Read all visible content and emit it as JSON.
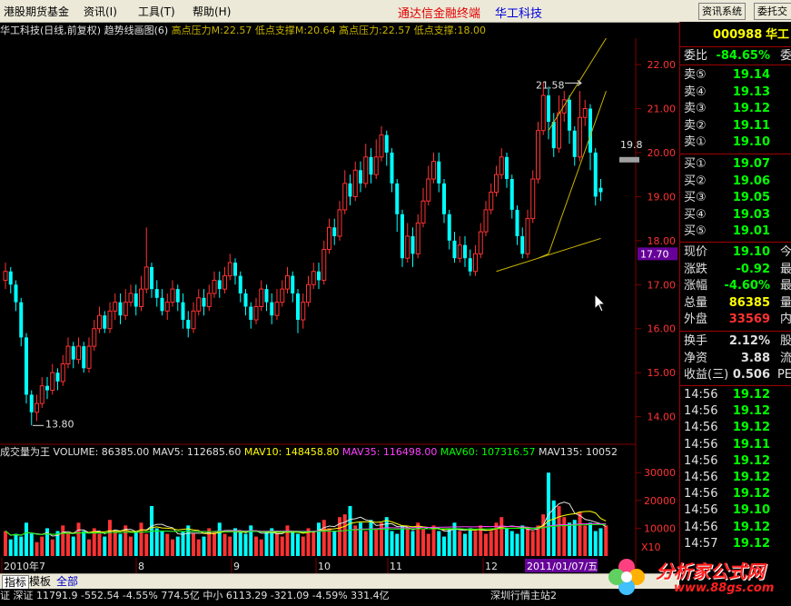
{
  "menubar": {
    "items": [
      {
        "label": "港股期货基金"
      },
      {
        "label": "资讯(I)"
      },
      {
        "label": "工具(T)"
      },
      {
        "label": "帮助(H)"
      }
    ],
    "app_title": "通达信金融终端",
    "stock_title": "华工科技",
    "btn_info": "资讯系统",
    "btn_trade": "委托交"
  },
  "chart_header": {
    "name": "华工科技(日线,前复权) 趋势线画图(6)",
    "hp_label": "高点压力M:",
    "hp_value": "22.57",
    "ls_label": "低点支撑M:",
    "ls_value": "20.64",
    "hp2_label": "高点压力:",
    "hp2_value": "22.57",
    "ls2_label": "低点支撑:",
    "ls2_value": "18.00"
  },
  "colors": {
    "up": "#ff3232",
    "down": "#00ffff",
    "trendline": "#c8b400",
    "grid": "#7f0000",
    "highlight": "#660099"
  },
  "chart_data": {
    "type": "candlestick",
    "ylim": [
      13.6,
      22.6
    ],
    "yticks": [
      "22.00",
      "21.00",
      "20.00",
      "19.00",
      "18.00",
      "17.00",
      "16.00",
      "15.00",
      "14.00"
    ],
    "annotations": {
      "high_label": "21.58",
      "low_label": "13.80",
      "right_label": "19.8",
      "price_tag": "17.70"
    },
    "candles": [
      [
        17.1,
        17.3,
        17.5,
        16.9
      ],
      [
        17.3,
        17.0,
        17.4,
        16.8
      ],
      [
        17.0,
        16.6,
        17.1,
        16.4
      ],
      [
        16.6,
        15.8,
        16.7,
        15.6
      ],
      [
        15.8,
        14.5,
        15.9,
        14.3
      ],
      [
        14.5,
        14.1,
        14.6,
        13.8
      ],
      [
        14.1,
        14.3,
        14.5,
        13.9
      ],
      [
        14.3,
        14.7,
        14.9,
        14.2
      ],
      [
        14.7,
        14.6,
        14.9,
        14.4
      ],
      [
        14.6,
        15.0,
        15.2,
        14.5
      ],
      [
        15.0,
        14.8,
        15.1,
        14.6
      ],
      [
        14.8,
        15.2,
        15.4,
        14.7
      ],
      [
        15.2,
        15.6,
        15.8,
        15.1
      ],
      [
        15.6,
        15.3,
        15.7,
        15.1
      ],
      [
        15.3,
        15.6,
        15.8,
        15.2
      ],
      [
        15.6,
        15.1,
        15.7,
        15.0
      ],
      [
        15.1,
        15.6,
        15.8,
        15.0
      ],
      [
        15.6,
        16.0,
        16.2,
        15.5
      ],
      [
        16.0,
        16.3,
        16.5,
        15.9
      ],
      [
        16.3,
        16.0,
        16.4,
        15.9
      ],
      [
        16.0,
        16.4,
        16.6,
        15.9
      ],
      [
        16.4,
        16.6,
        16.8,
        16.2
      ],
      [
        16.6,
        16.3,
        16.8,
        16.1
      ],
      [
        16.3,
        16.6,
        16.9,
        16.2
      ],
      [
        16.6,
        16.8,
        17.0,
        16.5
      ],
      [
        16.8,
        16.5,
        17.0,
        16.3
      ],
      [
        16.5,
        16.9,
        17.2,
        16.4
      ],
      [
        16.9,
        17.4,
        18.3,
        16.8
      ],
      [
        17.4,
        16.9,
        17.5,
        16.7
      ],
      [
        16.9,
        16.7,
        17.1,
        16.5
      ],
      [
        16.7,
        16.4,
        16.9,
        16.3
      ],
      [
        16.4,
        16.6,
        16.8,
        16.2
      ],
      [
        16.6,
        16.9,
        17.1,
        16.5
      ],
      [
        16.9,
        16.6,
        17.0,
        16.4
      ],
      [
        16.6,
        16.2,
        16.8,
        16.0
      ],
      [
        16.2,
        16.0,
        16.4,
        15.8
      ],
      [
        16.0,
        16.4,
        16.6,
        15.9
      ],
      [
        16.4,
        16.7,
        16.9,
        16.3
      ],
      [
        16.7,
        16.5,
        16.9,
        16.3
      ],
      [
        16.5,
        16.8,
        17.0,
        16.4
      ],
      [
        16.8,
        17.1,
        17.3,
        16.7
      ],
      [
        17.1,
        16.9,
        17.3,
        16.7
      ],
      [
        16.9,
        17.2,
        17.4,
        16.8
      ],
      [
        17.2,
        17.5,
        17.7,
        17.1
      ],
      [
        17.5,
        17.2,
        17.6,
        17.0
      ],
      [
        17.2,
        16.8,
        17.3,
        16.6
      ],
      [
        16.8,
        16.5,
        16.9,
        16.3
      ],
      [
        16.5,
        16.2,
        16.6,
        16.0
      ],
      [
        16.2,
        16.5,
        16.7,
        16.1
      ],
      [
        16.5,
        16.9,
        17.1,
        16.4
      ],
      [
        16.9,
        16.6,
        17.0,
        16.4
      ],
      [
        16.6,
        16.3,
        16.8,
        16.1
      ],
      [
        16.3,
        16.6,
        16.9,
        16.2
      ],
      [
        16.6,
        16.9,
        17.1,
        16.5
      ],
      [
        16.9,
        17.2,
        17.4,
        16.8
      ],
      [
        17.2,
        16.8,
        17.3,
        16.6
      ],
      [
        16.8,
        16.2,
        16.9,
        15.9
      ],
      [
        16.2,
        16.6,
        16.8,
        16.0
      ],
      [
        16.6,
        17.0,
        17.2,
        16.5
      ],
      [
        17.0,
        17.3,
        17.5,
        16.9
      ],
      [
        17.3,
        17.1,
        17.5,
        16.9
      ],
      [
        17.1,
        17.8,
        18.0,
        17.0
      ],
      [
        17.8,
        18.3,
        18.5,
        17.7
      ],
      [
        18.3,
        18.1,
        18.5,
        17.9
      ],
      [
        18.1,
        18.7,
        18.9,
        18.0
      ],
      [
        18.7,
        19.3,
        19.6,
        18.6
      ],
      [
        19.3,
        19.0,
        19.5,
        18.8
      ],
      [
        19.0,
        19.6,
        19.8,
        18.9
      ],
      [
        19.6,
        19.3,
        19.8,
        19.1
      ],
      [
        19.3,
        19.9,
        20.2,
        19.2
      ],
      [
        19.9,
        19.5,
        20.1,
        19.3
      ],
      [
        19.5,
        19.9,
        20.3,
        19.4
      ],
      [
        19.9,
        20.4,
        20.6,
        19.8
      ],
      [
        20.4,
        20.0,
        20.5,
        19.7
      ],
      [
        20.0,
        19.3,
        20.1,
        19.1
      ],
      [
        19.3,
        18.6,
        19.4,
        18.2
      ],
      [
        18.6,
        17.6,
        18.7,
        17.4
      ],
      [
        17.6,
        18.1,
        18.4,
        17.5
      ],
      [
        18.1,
        17.7,
        18.3,
        17.4
      ],
      [
        17.7,
        18.4,
        18.6,
        17.6
      ],
      [
        18.4,
        18.9,
        19.2,
        18.3
      ],
      [
        18.9,
        19.4,
        19.7,
        18.8
      ],
      [
        19.4,
        19.8,
        20.0,
        19.3
      ],
      [
        19.8,
        19.3,
        20.0,
        19.1
      ],
      [
        19.3,
        18.6,
        19.4,
        18.4
      ],
      [
        18.6,
        18.0,
        18.7,
        17.8
      ],
      [
        18.0,
        17.6,
        18.2,
        17.5
      ],
      [
        17.6,
        17.9,
        18.1,
        17.5
      ],
      [
        17.9,
        17.6,
        18.1,
        17.4
      ],
      [
        17.6,
        17.3,
        17.8,
        17.2
      ],
      [
        17.3,
        17.7,
        17.9,
        17.2
      ],
      [
        17.7,
        18.2,
        18.4,
        17.6
      ],
      [
        18.2,
        18.7,
        18.9,
        18.1
      ],
      [
        18.7,
        19.1,
        19.3,
        18.6
      ],
      [
        19.1,
        19.5,
        19.7,
        19.0
      ],
      [
        19.5,
        19.9,
        20.1,
        19.4
      ],
      [
        19.9,
        19.4,
        20.0,
        19.2
      ],
      [
        19.4,
        18.7,
        19.5,
        18.5
      ],
      [
        18.7,
        18.1,
        18.8,
        17.9
      ],
      [
        18.1,
        17.7,
        18.3,
        17.6
      ],
      [
        17.7,
        18.5,
        18.7,
        17.6
      ],
      [
        18.5,
        19.4,
        19.6,
        18.4
      ],
      [
        19.4,
        20.5,
        20.7,
        19.3
      ],
      [
        20.5,
        21.3,
        21.6,
        20.4
      ],
      [
        21.3,
        20.7,
        21.5,
        20.3
      ],
      [
        20.7,
        20.1,
        20.9,
        19.9
      ],
      [
        20.1,
        20.9,
        21.3,
        20.0
      ],
      [
        20.9,
        21.2,
        21.4,
        20.7
      ],
      [
        21.2,
        20.5,
        21.3,
        20.2
      ],
      [
        20.5,
        19.9,
        20.6,
        19.7
      ],
      [
        19.9,
        20.8,
        21.4,
        19.8
      ],
      [
        20.8,
        21.0,
        21.2,
        20.6
      ],
      [
        21.0,
        20.0,
        21.1,
        19.6
      ],
      [
        20.0,
        19.0,
        20.1,
        18.8
      ],
      [
        19.2,
        19.1,
        19.4,
        18.9
      ]
    ]
  },
  "volume": {
    "header": {
      "name": "成交量为王",
      "volume_label": "VOLUME:",
      "volume_value": "86385.00",
      "mav5_label": "MAV5:",
      "mav5_value": "112685.60",
      "mav10_label": "MAV10:",
      "mav10_value": "148458.80",
      "mav35_label": "MAV35:",
      "mav35_value": "116498.00",
      "mav60_label": "MAV60:",
      "mav60_value": "107316.57",
      "mav135_label": "MAV135:",
      "mav135_value": "10052"
    },
    "yticks": [
      "30000",
      "20000",
      "10000"
    ],
    "unit": "X10",
    "month_labels": [
      "2010年7",
      "8",
      "9",
      "10",
      "11",
      "12"
    ],
    "cursor_date": "2011/01/07/五",
    "values": [
      9,
      6,
      8,
      7,
      12,
      8,
      5,
      7,
      10,
      6,
      9,
      11,
      8,
      7,
      12,
      9,
      6,
      10,
      8,
      7,
      13,
      9,
      8,
      11,
      7,
      9,
      12,
      8,
      18,
      10,
      9,
      8,
      6,
      7,
      9,
      11,
      8,
      6,
      7,
      10,
      9,
      12,
      8,
      7,
      10,
      9,
      8,
      11,
      7,
      6,
      9,
      10,
      8,
      7,
      11,
      9,
      8,
      7,
      10,
      9,
      12,
      13,
      10,
      9,
      14,
      15,
      18,
      11,
      12,
      9,
      13,
      10,
      12,
      14,
      9,
      8,
      11,
      10,
      9,
      12,
      10,
      8,
      11,
      9,
      7,
      10,
      12,
      9,
      8,
      10,
      9,
      11,
      8,
      9,
      12,
      14,
      10,
      9,
      8,
      11,
      10,
      9,
      11,
      15,
      30,
      20,
      18,
      14,
      12,
      13,
      16,
      11,
      12,
      9,
      10,
      11
    ]
  },
  "bottom_tabs": [
    "指标",
    "模板",
    "全部"
  ],
  "quote_panel": {
    "code": "000988",
    "name": "华工",
    "ratio_label": "委比",
    "ratio_value": "-84.65%",
    "ratio_extra": "委",
    "asks": [
      {
        "label": "卖⑤",
        "price": "19.14"
      },
      {
        "label": "卖④",
        "price": "19.13"
      },
      {
        "label": "卖③",
        "price": "19.12"
      },
      {
        "label": "卖②",
        "price": "19.11"
      },
      {
        "label": "卖①",
        "price": "19.10"
      }
    ],
    "bids": [
      {
        "label": "买①",
        "price": "19.07"
      },
      {
        "label": "买②",
        "price": "19.06"
      },
      {
        "label": "买③",
        "price": "19.05"
      },
      {
        "label": "买④",
        "price": "19.03"
      },
      {
        "label": "买⑤",
        "price": "19.01"
      }
    ],
    "stats": [
      {
        "label": "现价",
        "value": "19.10",
        "extra": "今",
        "color": "#00ff00"
      },
      {
        "label": "涨跌",
        "value": "-0.92",
        "extra": "最",
        "color": "#00ff00"
      },
      {
        "label": "涨幅",
        "value": "-4.60%",
        "extra": "最",
        "color": "#00ff00"
      },
      {
        "label": "总量",
        "value": "86385",
        "extra": "量",
        "color": "#ffff00"
      },
      {
        "label": "外盘",
        "value": "33569",
        "extra": "内",
        "color": "#ff3232"
      }
    ],
    "stats2": [
      {
        "label": "换手",
        "value": "2.12%",
        "extra": "股",
        "color": "#e0e0e0"
      },
      {
        "label": "净资",
        "value": "3.88",
        "extra": "流",
        "color": "#e0e0e0"
      },
      {
        "label": "收益(三)",
        "value": "0.506",
        "extra": "PE",
        "color": "#e0e0e0"
      }
    ],
    "ticks": [
      {
        "time": "14:56",
        "price": "19.12"
      },
      {
        "time": "14:56",
        "price": "19.12"
      },
      {
        "time": "14:56",
        "price": "19.12"
      },
      {
        "time": "14:56",
        "price": "19.11"
      },
      {
        "time": "14:56",
        "price": "19.12"
      },
      {
        "time": "14:56",
        "price": "19.12"
      },
      {
        "time": "14:56",
        "price": "19.12"
      },
      {
        "time": "14:56",
        "price": "19.10"
      },
      {
        "time": "14:56",
        "price": "19.12"
      },
      {
        "time": "14:57",
        "price": "19.12"
      }
    ]
  },
  "status_bar": {
    "text": "证 深证 11791.9 -552.54 -4.55%  774.5亿  中小 6113.29 -321.09 -4.59%  331.4亿",
    "message": "深圳行情主站2"
  },
  "watermark": {
    "text": "分析家公式网",
    "url": "www.88gs.com"
  }
}
